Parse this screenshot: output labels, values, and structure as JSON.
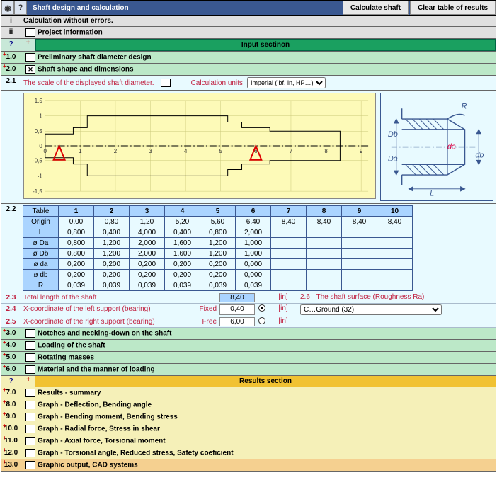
{
  "header": {
    "title": "Shaft design and calculation",
    "btn_calc": "Calculate shaft",
    "btn_clear": "Clear table of results"
  },
  "rows": {
    "i": {
      "idx": "i",
      "label": "Calculation without errors."
    },
    "ii": {
      "idx": "ii",
      "label": "Project information"
    },
    "r1": {
      "idx": "1.0",
      "label": "Preliminary shaft diameter design"
    },
    "r2": {
      "idx": "2.0",
      "label": "Shaft shape and dimensions"
    },
    "r2_1": {
      "idx": "2.1",
      "label": "The scale of the displayed shaft diameter.",
      "calc_units": "Calculation units",
      "units_sel": "Imperial (lbf, in, HP…)"
    },
    "r2_2": {
      "idx": "2.2"
    },
    "r2_3": {
      "idx": "2.3",
      "label": "Total length of the shaft",
      "val": "8,40",
      "unit": "[in]"
    },
    "r2_4": {
      "idx": "2.4",
      "label": "X-coordinate of the left support (bearing)",
      "mid": "Fixed",
      "val": "0,40",
      "unit": "[in]"
    },
    "r2_5": {
      "idx": "2.5",
      "label": "X-coordinate of the right support (bearing)",
      "mid": "Free",
      "val": "6,00",
      "unit": "[in]"
    },
    "r2_6": {
      "idx": "2.6",
      "label": "The shaft surface (Roughness Ra)",
      "select": "C…Ground  (32)"
    },
    "r3": {
      "idx": "3.0",
      "label": "Notches and necking-down on the shaft"
    },
    "r4": {
      "idx": "4.0",
      "label": "Loading of the shaft"
    },
    "r5": {
      "idx": "5.0",
      "label": "Rotating masses"
    },
    "r6": {
      "idx": "6.0",
      "label": "Material and the manner of loading"
    },
    "r7": {
      "idx": "7.0",
      "label": "Results - summary"
    },
    "r8": {
      "idx": "8.0",
      "label": "Graph - Deflection, Bending angle"
    },
    "r9": {
      "idx": "9.0",
      "label": "Graph - Bending moment, Bending stress"
    },
    "r10": {
      "idx": "10.0",
      "label": "Graph - Radial force, Stress in shear"
    },
    "r11": {
      "idx": "11.0",
      "label": "Graph - Axial force,   Torsional moment"
    },
    "r12": {
      "idx": "12.0",
      "label": "Graph - Torsional angle,   Reduced stress,   Safety coeficient"
    },
    "r13": {
      "idx": "13.0",
      "label": "Graphic output, CAD systems"
    }
  },
  "input_section": "Input sectinon",
  "results_section": "Results section",
  "table": {
    "headers": [
      "Table",
      "1",
      "2",
      "3",
      "4",
      "5",
      "6",
      "7",
      "8",
      "9",
      "10"
    ],
    "rows": [
      {
        "n": "Origin",
        "v": [
          "0,00",
          "0,80",
          "1,20",
          "5,20",
          "5,60",
          "6,40",
          "8,40",
          "8,40",
          "8,40",
          "8,40"
        ]
      },
      {
        "n": "L",
        "v": [
          "0,800",
          "0,400",
          "4,000",
          "0,400",
          "0,800",
          "2,000",
          "",
          "",
          "",
          ""
        ]
      },
      {
        "n": "ø Da",
        "v": [
          "0,800",
          "1,200",
          "2,000",
          "1,600",
          "1,200",
          "1,000",
          "",
          "",
          "",
          ""
        ]
      },
      {
        "n": "ø Db",
        "v": [
          "0,800",
          "1,200",
          "2,000",
          "1,600",
          "1,200",
          "1,000",
          "",
          "",
          "",
          ""
        ]
      },
      {
        "n": "ø da",
        "v": [
          "0,200",
          "0,200",
          "0,200",
          "0,200",
          "0,200",
          "0,000",
          "",
          "",
          "",
          ""
        ]
      },
      {
        "n": "ø db",
        "v": [
          "0,200",
          "0,200",
          "0,200",
          "0,200",
          "0,200",
          "0,000",
          "",
          "",
          "",
          ""
        ]
      },
      {
        "n": "R",
        "v": [
          "0,039",
          "0,039",
          "0,039",
          "0,039",
          "0,039",
          "0,039",
          "",
          "",
          "",
          ""
        ]
      }
    ]
  },
  "schematic": {
    "R": "R",
    "Db": "Db",
    "Da": "Da",
    "da": "da",
    "db": "db",
    "L": "L"
  },
  "chart_data": {
    "type": "line",
    "title": "",
    "xlabel": "",
    "ylabel": "",
    "xlim": [
      0,
      9
    ],
    "ylim": [
      -1.5,
      1.5
    ],
    "x_ticks": [
      0,
      1,
      2,
      3,
      4,
      5,
      6,
      7,
      8,
      9
    ],
    "y_ticks": [
      -1.5,
      -1,
      -0.5,
      0,
      0.5,
      1,
      1.5
    ],
    "supports_x": [
      0.4,
      6.0
    ],
    "shaft_profile": {
      "segments": [
        {
          "x0": 0.0,
          "x1": 0.8,
          "Da": 0.8,
          "Db": 0.8
        },
        {
          "x0": 0.8,
          "x1": 1.2,
          "Da": 1.2,
          "Db": 1.2
        },
        {
          "x0": 1.2,
          "x1": 5.2,
          "Da": 2.0,
          "Db": 2.0
        },
        {
          "x0": 5.2,
          "x1": 5.6,
          "Da": 1.6,
          "Db": 1.6
        },
        {
          "x0": 5.6,
          "x1": 6.4,
          "Da": 1.2,
          "Db": 1.2
        },
        {
          "x0": 6.4,
          "x1": 8.4,
          "Da": 1.0,
          "Db": 1.0
        }
      ],
      "axis_y": 0
    }
  }
}
